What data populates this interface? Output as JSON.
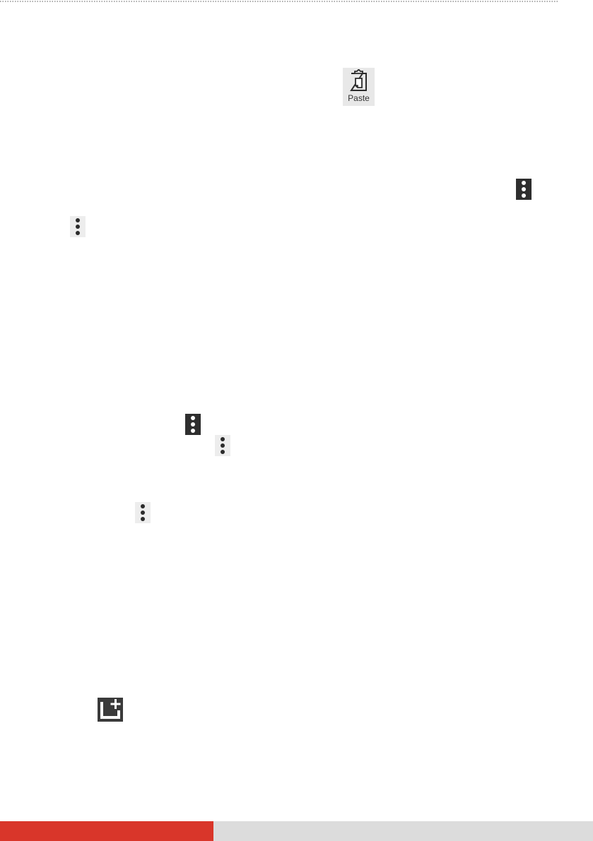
{
  "toolbar": {
    "paste_label": "Paste"
  },
  "icons": {
    "paste": "paste-icon",
    "overflow": "more-vertical-icon",
    "new_item": "new-item-icon"
  },
  "footer": {
    "progress_fraction": 0.36
  },
  "colors": {
    "accent_red": "#d9362a",
    "footer_track": "#dcdcdc",
    "icon_dark": "#2e2e2e",
    "icon_light_bg": "#ededed"
  }
}
